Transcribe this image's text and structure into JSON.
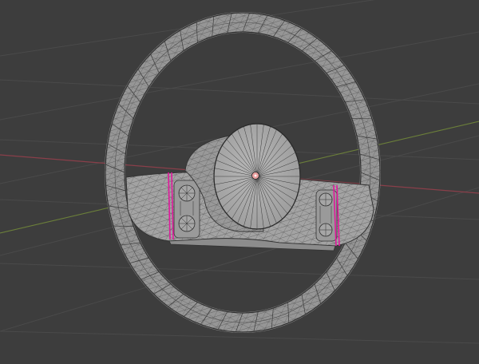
{
  "viewport": {
    "background": "#3d3d3d",
    "grid_color": "#4a4a4a",
    "x_axis_color": "#8a3f4a",
    "y_axis_color": "#6b7f3a"
  },
  "mesh": {
    "object": "steering-wheel",
    "shading": "solid",
    "overlay": "wireframe",
    "surface_color": "#a9a9a9",
    "edge_color": "#3a3a3a",
    "seam_color": "#e0189c"
  },
  "origin": {
    "icon": "object-origin-icon"
  }
}
